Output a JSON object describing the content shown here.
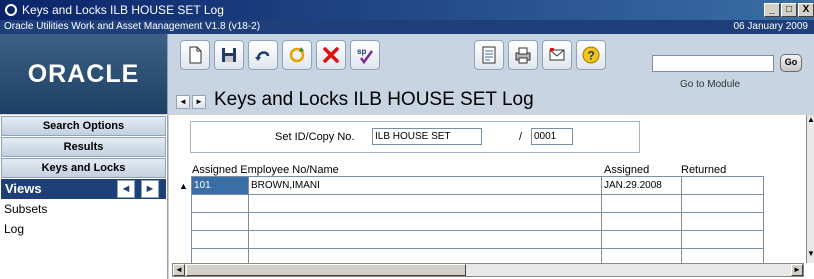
{
  "window": {
    "title": "Keys and Locks ILB HOUSE SET Log",
    "subtitle": "Oracle Utilities Work and Asset Management V1.8 (v18-2)",
    "date": "06 January  2009",
    "buttons": [
      "_",
      "□",
      "X"
    ]
  },
  "header": {
    "logo": "ORACLE",
    "toolbar_icons": [
      "new-document-icon",
      "save-icon",
      "undo-icon",
      "refresh-icon",
      "delete-icon",
      "spell-check-icon",
      "report-icon",
      "print-icon",
      "email-icon",
      "help-icon"
    ],
    "go_button": "Go",
    "go_label": "Go to Module",
    "nav_prev": "◄",
    "nav_next": "►",
    "page_title": "Keys and Locks ILB HOUSE SET Log"
  },
  "sidebar": {
    "buttons": [
      "Search Options",
      "Results",
      "Keys and Locks"
    ],
    "views_label": "Views",
    "views_prev": "◄",
    "views_next": "►",
    "view_items": [
      "Subsets",
      "Log"
    ]
  },
  "form": {
    "set_label": "Set ID/Copy No.",
    "set_id": "ILB HOUSE SET",
    "separator": "/",
    "copy_no": "0001"
  },
  "grid": {
    "headers": {
      "employee": "Assigned Employee No/Name",
      "assigned": "Assigned",
      "returned": "Returned"
    },
    "rows": [
      {
        "emp_no": "101",
        "name": "BROWN,IMANI",
        "assigned": "JAN.29.2008",
        "returned": ""
      },
      {
        "emp_no": "",
        "name": "",
        "assigned": "",
        "returned": ""
      },
      {
        "emp_no": "",
        "name": "",
        "assigned": "",
        "returned": ""
      },
      {
        "emp_no": "",
        "name": "",
        "assigned": "",
        "returned": ""
      },
      {
        "emp_no": "",
        "name": "",
        "assigned": "",
        "returned": ""
      }
    ]
  },
  "colors": {
    "title_bar": "#0a246a",
    "sub_bar": "#1e3f7a",
    "views_bar": "#1f3f78",
    "header_bg": "#c8d4e2"
  }
}
